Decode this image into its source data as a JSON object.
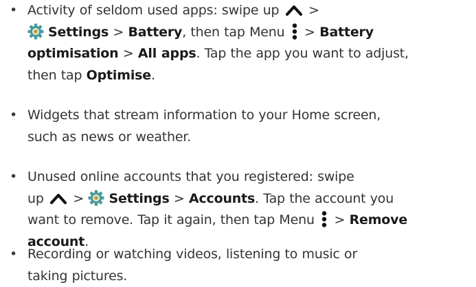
{
  "bullet_glyph": "•",
  "icons": {
    "chevron_up": "chevron-up-icon",
    "settings_gear": "settings-gear-icon",
    "menu_dots": "vertical-dots-menu-icon",
    "gear_color": "#4a9a9c",
    "gear_inner_color": "#f0b040"
  },
  "items": [
    {
      "t1": "Activity of seldom used apps: swipe up",
      "t2": ">",
      "t3": "Settings",
      "t4": ">",
      "t5": "Battery",
      "t6": ", then tap Menu",
      "t7": ">",
      "t8": "Battery",
      "t9": "optimisation",
      "t10": ">",
      "t11": "All apps",
      "t12": ". Tap the app you want to adjust,",
      "t13": "then tap",
      "t14": "Optimise",
      "t15": "."
    },
    {
      "t1": "Widgets that stream information to your Home screen,",
      "t2": "such as news or weather."
    },
    {
      "t1": "Unused online accounts that you registered: swipe",
      "t2": "up",
      "t3": ">",
      "t4": "Settings",
      "t5": ">",
      "t6": "Accounts",
      "t7": ". Tap the account you",
      "t8": "want to remove. Tap it again, then tap Menu",
      "t9": ">",
      "t10": "Remove",
      "t11": "account",
      "t12": "."
    },
    {
      "t1": "Recording or watching videos, listening to music or",
      "t2": "taking pictures."
    }
  ]
}
